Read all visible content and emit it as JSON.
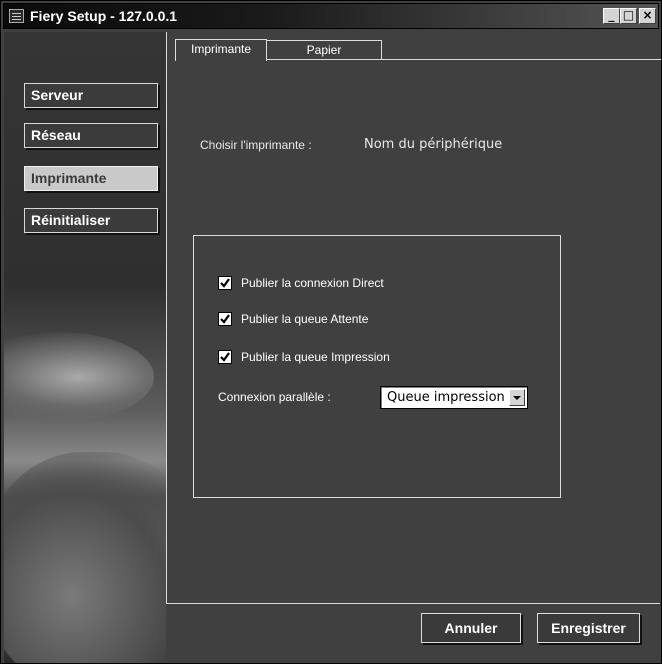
{
  "window": {
    "title": "Fiery Setup - 127.0.0.1"
  },
  "title_buttons": {
    "minimize": "_",
    "maximize": "□",
    "close": "×"
  },
  "sidebar": {
    "items": [
      {
        "label": "Serveur",
        "active": false
      },
      {
        "label": "Réseau",
        "active": false
      },
      {
        "label": "Imprimante",
        "active": true
      },
      {
        "label": "Réinitialiser",
        "active": false
      }
    ]
  },
  "tabs": [
    {
      "label": "Imprimante",
      "active": true
    },
    {
      "label": "Papier",
      "active": false
    }
  ],
  "printer": {
    "choose_label": "Choisir l'imprimante :",
    "device_name": "Nom du périphérique"
  },
  "options": {
    "checkboxes": [
      {
        "label": "Publier la connexion Direct",
        "checked": true
      },
      {
        "label": "Publier la queue Attente",
        "checked": true
      },
      {
        "label": "Publier la queue Impression",
        "checked": true
      }
    ],
    "parallel_label": "Connexion parallèle :",
    "parallel_value": "Queue impression"
  },
  "footer": {
    "cancel_label": "Annuler",
    "save_label": "Enregistrer"
  }
}
